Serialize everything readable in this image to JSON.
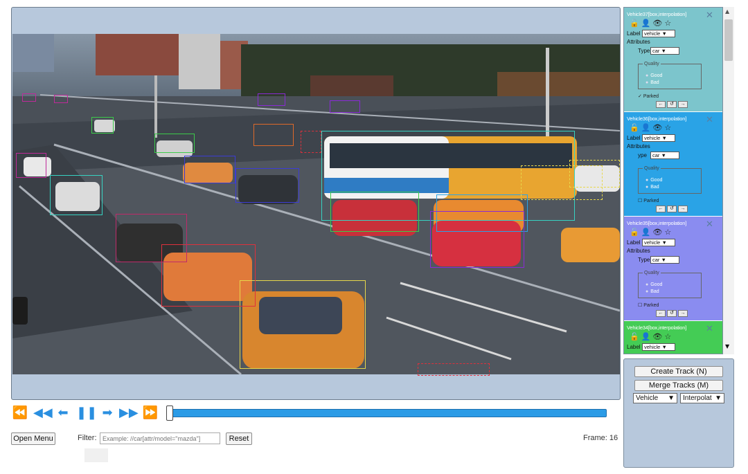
{
  "controls": {
    "icons": [
      "rewind-fast-icon",
      "rewind-icon",
      "step-back-icon",
      "pause-icon",
      "step-forward-icon",
      "forward-icon",
      "forward-fast-icon"
    ],
    "progress_fraction": 0.0
  },
  "toolbar": {
    "open_menu_label": "Open Menu",
    "filter_label": "Filter:",
    "filter_placeholder": "Example: //car[attr/model=\"mazda\"]",
    "reset_label": "Reset",
    "frame_text": "Frame: 16"
  },
  "annotations": [
    {
      "title": "Vehicle37[box,interpolation]",
      "label_caption": "Label",
      "label_value": "vehicle",
      "attributes_caption": "Attributes",
      "type_caption": "Type",
      "type_value": "car",
      "quality_caption": "Quality",
      "quality_options": [
        "Good",
        "Bad"
      ],
      "parked_caption": "Parked",
      "color": "#7cc5cc"
    },
    {
      "title": "Vehicle36[box,interpolation]",
      "label_caption": "Label",
      "label_value": "vehicle",
      "attributes_caption": "Attributes",
      "type_caption": "ype",
      "type_value": "car",
      "quality_caption": "Quality",
      "quality_options": [
        "Good",
        "Bad"
      ],
      "parked_caption": "Parked",
      "color": "#2aa3e6"
    },
    {
      "title": "Vehicle35[box,interpolation]",
      "label_caption": "Label",
      "label_value": "vehicle",
      "attributes_caption": "Attributes",
      "type_caption": "Type",
      "type_value": "car",
      "quality_caption": "Quality",
      "quality_options": [
        "Good",
        "Bad"
      ],
      "parked_caption": "Parked",
      "color": "#8a8cf0"
    },
    {
      "title": "Vehicle34[box,interpolation]",
      "label_caption": "Label",
      "label_value": "vehicle",
      "color": "#44cc55"
    }
  ],
  "track_panel": {
    "create_label": "Create Track (N)",
    "merge_label": "Merge Tracks (M)",
    "type_value": "Vehicle",
    "mode_value": "Interpolat"
  },
  "colors": {
    "accent": "#2b9be6",
    "panel": "#b7c8dc",
    "box_cyan": "#37d3c3",
    "box_green": "#3ccc4a",
    "box_blue": "#3c3cd6",
    "box_red": "#e0303c",
    "box_magenta": "#c02a9a",
    "box_yellow": "#e8d84a",
    "box_orange": "#e06a2a",
    "box_purple": "#8a2ad6"
  }
}
